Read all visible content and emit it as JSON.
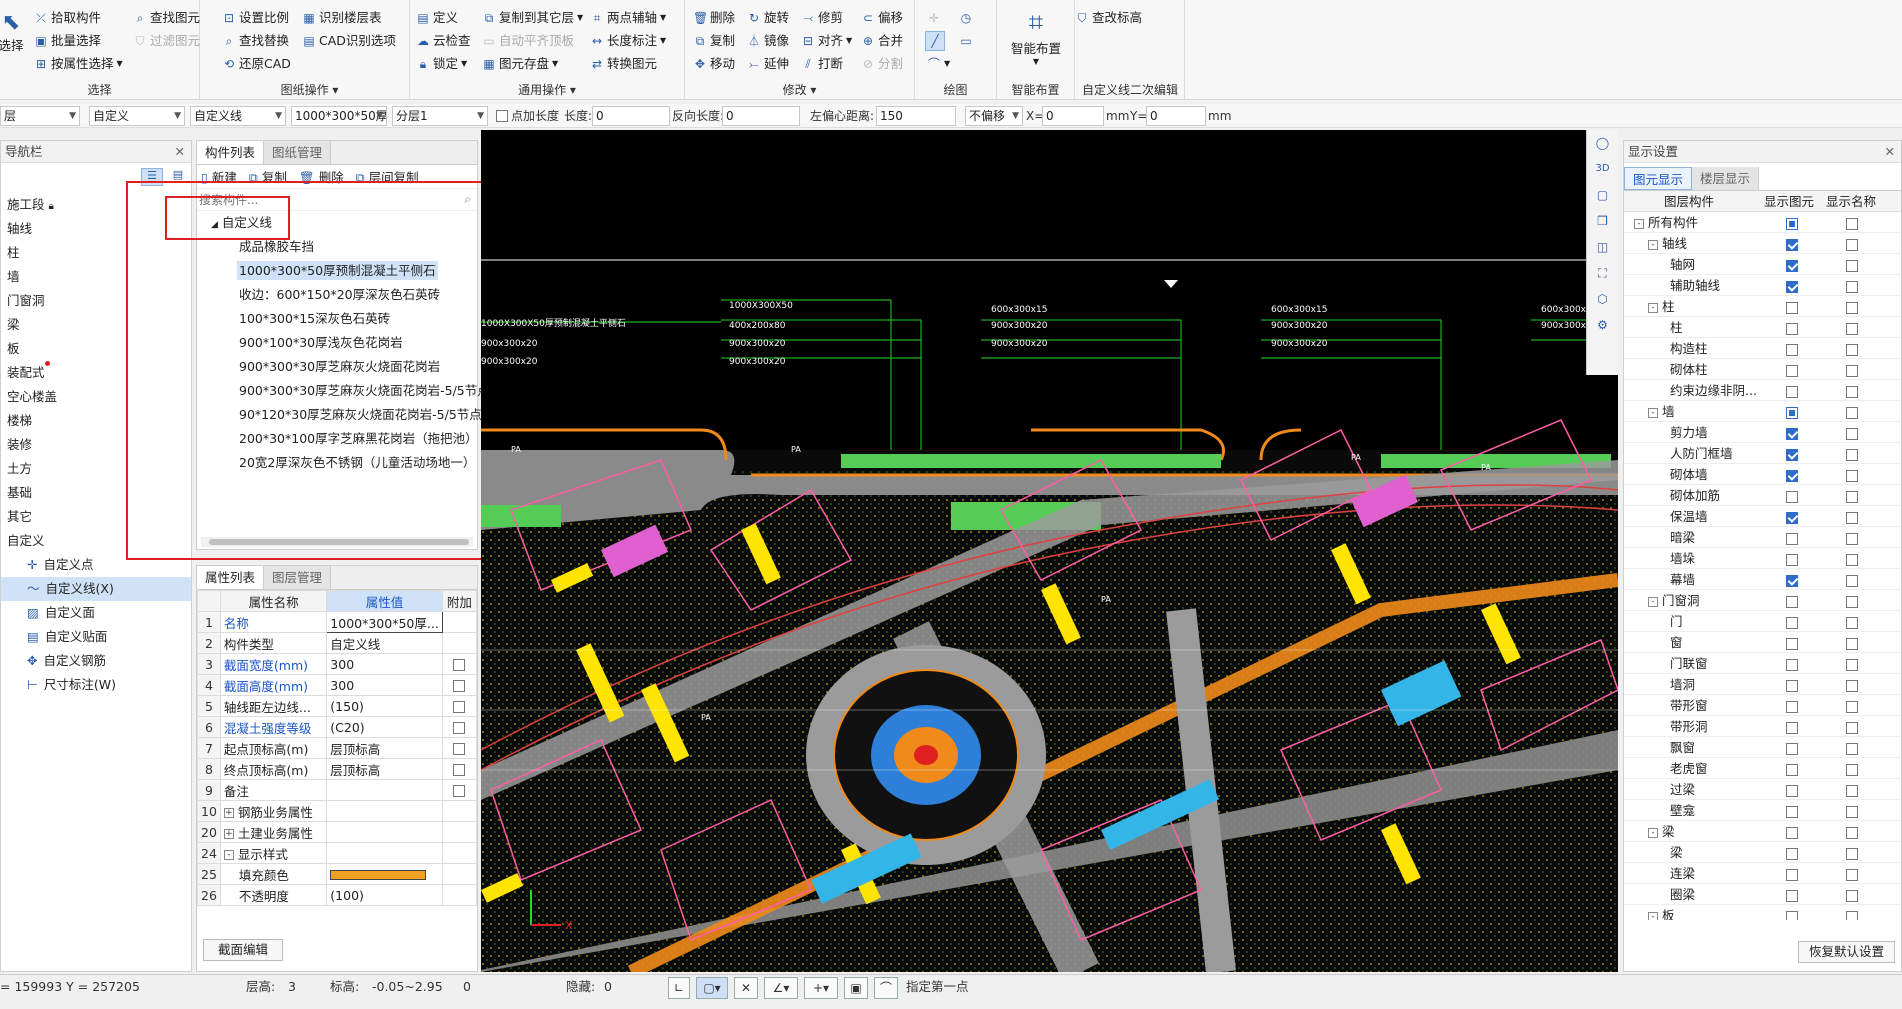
{
  "ribbon": {
    "select": {
      "label": "选择",
      "title": "选择",
      "items": [
        "拾取构件",
        "批量选择",
        "按属性选择",
        "查找图元",
        "过滤图元"
      ]
    },
    "drawing": {
      "title": "图纸操作",
      "items": [
        "设置比例",
        "查找替换",
        "还原CAD",
        "识别楼层表",
        "CAD识别选项"
      ]
    },
    "common": {
      "title": "通用操作",
      "items": [
        "定义",
        "云检查",
        "锁定",
        "复制到其它层",
        "自动平齐顶板",
        "图元存盘",
        "两点辅轴",
        "长度标注",
        "转换图元"
      ]
    },
    "modify": {
      "title": "修改",
      "items": [
        "删除",
        "复制",
        "移动",
        "旋转",
        "镜像",
        "延伸",
        "修剪",
        "对齐",
        "打断",
        "偏移",
        "合并",
        "分割"
      ]
    },
    "draw": {
      "title": "绘图"
    },
    "smart": {
      "title": "智能布置",
      "label": "智能布置"
    },
    "secondary": {
      "title": "自定义线二次编辑",
      "items": [
        "查改标高"
      ]
    }
  },
  "toolbar": {
    "floor": "层",
    "type1": "自定义",
    "type2": "自定义线",
    "comp": "1000*300*50厚",
    "layer": "分层1",
    "point_len_label": "点加长度",
    "len_label": "长度:",
    "len_val": "0",
    "rev_len_label": "反向长度:",
    "rev_len_val": "0",
    "offset_label": "左偏心距离:",
    "offset_val": "150",
    "nooffset": "不偏移",
    "x_label": "X=",
    "x_val": "0",
    "mm1": "mm",
    "y_label": "Y=",
    "y_val": "0",
    "mm2": "mm"
  },
  "nav": {
    "title": "导航栏",
    "items": [
      "施工段",
      "轴线",
      "柱",
      "墙",
      "门窗洞",
      "梁",
      "板",
      "装配式",
      "空心楼盖",
      "楼梯",
      "装修",
      "土方",
      "基础",
      "其它",
      "自定义"
    ],
    "subitems": [
      "自定义点",
      "自定义线(X)",
      "自定义面",
      "自定义贴面",
      "自定义钢筋",
      "尺寸标注(W)"
    ]
  },
  "comp_list": {
    "tabs": [
      "构件列表",
      "图纸管理"
    ],
    "actions": [
      "新建",
      "复制",
      "删除",
      "层间复制"
    ],
    "search_placeholder": "搜索构件...",
    "root": "自定义线",
    "items": [
      "成品橡胶车挡",
      "1000*300*50厚预制混凝土平侧石",
      "收边：600*150*20厚深灰色石英砖",
      "100*300*15深灰色石英砖",
      "900*100*30厚浅灰色花岗岩",
      "900*300*30厚芝麻灰火烧面花岗岩",
      "900*300*30厚芝麻灰火烧面花岗岩-5/5节点",
      "90*120*30厚芝麻灰火烧面花岗岩-5/5节点",
      "200*30*100厚字芝麻黑花岗岩（拖把池）",
      "20宽2厚深灰色不锈钢（儿童活动场地一）"
    ],
    "selected_index": 1
  },
  "props": {
    "tabs": [
      "属性列表",
      "图层管理"
    ],
    "headers": [
      "属性名称",
      "属性值",
      "附加"
    ],
    "rows": [
      {
        "n": "1",
        "name": "名称",
        "value": "1000*300*50厚...",
        "blue": true,
        "chk": false
      },
      {
        "n": "2",
        "name": "构件类型",
        "value": "自定义线",
        "blue": false,
        "chk": false
      },
      {
        "n": "3",
        "name": "截面宽度(mm)",
        "value": "300",
        "blue": true,
        "chk": true
      },
      {
        "n": "4",
        "name": "截面高度(mm)",
        "value": "300",
        "blue": true,
        "chk": true
      },
      {
        "n": "5",
        "name": "轴线距左边线...",
        "value": "(150)",
        "blue": false,
        "chk": true
      },
      {
        "n": "6",
        "name": "混凝土强度等级",
        "value": "(C20)",
        "blue": true,
        "chk": true
      },
      {
        "n": "7",
        "name": "起点顶标高(m)",
        "value": "层顶标高",
        "blue": false,
        "chk": true
      },
      {
        "n": "8",
        "name": "终点顶标高(m)",
        "value": "层顶标高",
        "blue": false,
        "chk": true
      },
      {
        "n": "9",
        "name": "备注",
        "value": "",
        "blue": false,
        "chk": true
      },
      {
        "n": "10",
        "name": "钢筋业务属性",
        "value": "",
        "blue": false,
        "chk": false,
        "group": "+"
      },
      {
        "n": "20",
        "name": "土建业务属性",
        "value": "",
        "blue": false,
        "chk": false,
        "group": "+"
      },
      {
        "n": "24",
        "name": "显示样式",
        "value": "",
        "blue": false,
        "chk": false,
        "group": "-"
      },
      {
        "n": "25",
        "name": "填充颜色",
        "value": "",
        "blue": false,
        "chk": false,
        "color": "#f0a020"
      },
      {
        "n": "26",
        "name": "不透明度",
        "value": "(100)",
        "blue": false,
        "chk": false
      }
    ],
    "section_btn": "截面编辑"
  },
  "display": {
    "title": "显示设置",
    "tabs": [
      "图元显示",
      "楼层显示"
    ],
    "headers": [
      "图层构件",
      "显示图元",
      "显示名称"
    ],
    "rows": [
      {
        "name": "所有构件",
        "lvl": 0,
        "exp": "-",
        "a": "part",
        "b": "off"
      },
      {
        "name": "轴线",
        "lvl": 1,
        "exp": "-",
        "a": "on",
        "b": "off"
      },
      {
        "name": "轴网",
        "lvl": 2,
        "a": "on",
        "b": "off"
      },
      {
        "name": "辅助轴线",
        "lvl": 2,
        "a": "on",
        "b": "off"
      },
      {
        "name": "柱",
        "lvl": 1,
        "exp": "-",
        "a": "off",
        "b": "off"
      },
      {
        "name": "柱",
        "lvl": 2,
        "a": "off",
        "b": "off"
      },
      {
        "name": "构造柱",
        "lvl": 2,
        "a": "off",
        "b": "off"
      },
      {
        "name": "砌体柱",
        "lvl": 2,
        "a": "off",
        "b": "off"
      },
      {
        "name": "约束边缘非阴...",
        "lvl": 2,
        "a": "off",
        "b": "off"
      },
      {
        "name": "墙",
        "lvl": 1,
        "exp": "-",
        "a": "part",
        "b": "off"
      },
      {
        "name": "剪力墙",
        "lvl": 2,
        "a": "on",
        "b": "off"
      },
      {
        "name": "人防门框墙",
        "lvl": 2,
        "a": "on",
        "b": "off"
      },
      {
        "name": "砌体墙",
        "lvl": 2,
        "a": "on",
        "b": "off"
      },
      {
        "name": "砌体加筋",
        "lvl": 2,
        "a": "off",
        "b": "off"
      },
      {
        "name": "保温墙",
        "lvl": 2,
        "a": "on",
        "b": "off"
      },
      {
        "name": "暗梁",
        "lvl": 2,
        "a": "off",
        "b": "off"
      },
      {
        "name": "墙垛",
        "lvl": 2,
        "a": "off",
        "b": "off"
      },
      {
        "name": "幕墙",
        "lvl": 2,
        "a": "on",
        "b": "off"
      },
      {
        "name": "门窗洞",
        "lvl": 1,
        "exp": "-",
        "a": "off",
        "b": "off"
      },
      {
        "name": "门",
        "lvl": 2,
        "a": "off",
        "b": "off"
      },
      {
        "name": "窗",
        "lvl": 2,
        "a": "off",
        "b": "off"
      },
      {
        "name": "门联窗",
        "lvl": 2,
        "a": "off",
        "b": "off"
      },
      {
        "name": "墙洞",
        "lvl": 2,
        "a": "off",
        "b": "off"
      },
      {
        "name": "带形窗",
        "lvl": 2,
        "a": "off",
        "b": "off"
      },
      {
        "name": "带形洞",
        "lvl": 2,
        "a": "off",
        "b": "off"
      },
      {
        "name": "飘窗",
        "lvl": 2,
        "a": "off",
        "b": "off"
      },
      {
        "name": "老虎窗",
        "lvl": 2,
        "a": "off",
        "b": "off"
      },
      {
        "name": "过梁",
        "lvl": 2,
        "a": "off",
        "b": "off"
      },
      {
        "name": "壁龛",
        "lvl": 2,
        "a": "off",
        "b": "off"
      },
      {
        "name": "梁",
        "lvl": 1,
        "exp": "-",
        "a": "off",
        "b": "off"
      },
      {
        "name": "梁",
        "lvl": 2,
        "a": "off",
        "b": "off"
      },
      {
        "name": "连梁",
        "lvl": 2,
        "a": "off",
        "b": "off"
      },
      {
        "name": "圈梁",
        "lvl": 2,
        "a": "off",
        "b": "off"
      },
      {
        "name": "板",
        "lvl": 1,
        "exp": "-",
        "a": "off",
        "b": "off"
      }
    ],
    "reset_btn": "恢复默认设置"
  },
  "canvas": {
    "labels": [
      "1000X300X50厚预制混凝土平侧石",
      "1000X300X50",
      "400x200x80",
      "900x300x20",
      "600x300x15",
      "900x300x20",
      "PA"
    ],
    "axis_x": "X"
  },
  "status": {
    "coords": "= 159993 Y = 257205",
    "floor_h_label": "层高:",
    "floor_h": "3",
    "elev_label": "标高:",
    "elev": "-0.05~2.95",
    "zero": "0",
    "hidden_label": "隐藏:",
    "hidden": "0",
    "hint": "指定第一点"
  }
}
